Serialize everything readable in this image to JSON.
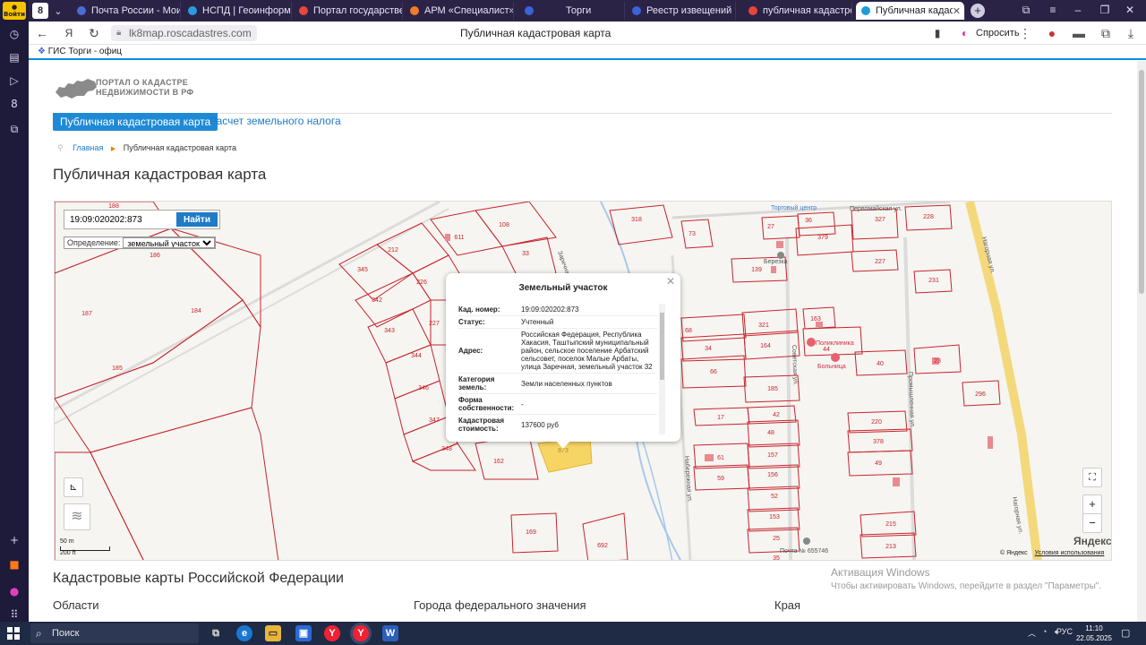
{
  "sidebar": {
    "login_label": "Войти"
  },
  "tabs": [
    {
      "label": "Почта России - Мои отп",
      "color": "#4c6bd8"
    },
    {
      "label": "НСПД | Геоинформаци",
      "color": "#2a9be0"
    },
    {
      "label": "Портал государственн",
      "color": "#e8453c"
    },
    {
      "label": "АРМ «Специалист»",
      "color": "#ef7b2f"
    },
    {
      "label": "Торги",
      "color": "#3a63d8"
    },
    {
      "label": "Реестр извещений",
      "color": "#3a63d8"
    },
    {
      "label": "публичная кадастрова",
      "color": "#e8453c"
    },
    {
      "label": "Публичная кадастрова",
      "color": "#1e9cd8"
    }
  ],
  "browser": {
    "url": "lk8map.roscadastres.com",
    "title": "Публичная кадастровая карта",
    "ask_label": "Спросить",
    "bookmark": "ГИС Торги - офиц"
  },
  "site": {
    "logo_line1": "ПОРТАЛ О КАДАСТРЕ",
    "logo_line2": "НЕДВИЖИМОСТИ В РФ",
    "nav_active": "Публичная кадастровая карта",
    "nav_tax": "Расчет земельного налога",
    "crumb_home": "Главная",
    "crumb_current": "Публичная кадастровая карта",
    "heading": "Публичная кадастровая карта"
  },
  "map": {
    "search_value": "19:09:020202:873",
    "search_button": "Найти",
    "definition_label": "Определение:",
    "definition_value": "земельный участок",
    "scale_m": "50 m",
    "scale_ft": "200 ft",
    "yandex": "Яндекс",
    "copyright": "© Яндекс",
    "terms": "Условия использования",
    "parcel_labels": [
      {
        "t": "188"
      },
      {
        "t": "186"
      },
      {
        "t": "187"
      },
      {
        "t": "184"
      },
      {
        "t": "185"
      },
      {
        "t": "345"
      },
      {
        "t": "212"
      },
      {
        "t": "342"
      },
      {
        "t": "226"
      },
      {
        "t": "343"
      },
      {
        "t": "227"
      },
      {
        "t": "344"
      },
      {
        "t": "346"
      },
      {
        "t": "347"
      },
      {
        "t": "348"
      },
      {
        "t": "162"
      },
      {
        "t": "611"
      },
      {
        "t": "108"
      },
      {
        "t": "33"
      },
      {
        "t": "318"
      },
      {
        "t": "73"
      },
      {
        "t": "27"
      },
      {
        "t": "36"
      },
      {
        "t": "379"
      },
      {
        "t": "327"
      },
      {
        "t": "228"
      },
      {
        "t": "227"
      },
      {
        "t": "139"
      },
      {
        "t": "231"
      },
      {
        "t": "68"
      },
      {
        "t": "321"
      },
      {
        "t": "163"
      },
      {
        "t": "34"
      },
      {
        "t": "164"
      },
      {
        "t": "44"
      },
      {
        "t": "66"
      },
      {
        "t": "40"
      },
      {
        "t": "23"
      },
      {
        "t": "185"
      },
      {
        "t": "296"
      },
      {
        "t": "17"
      },
      {
        "t": "42"
      },
      {
        "t": "220"
      },
      {
        "t": "48"
      },
      {
        "t": "378"
      },
      {
        "t": "61"
      },
      {
        "t": "157"
      },
      {
        "t": "49"
      },
      {
        "t": "59"
      },
      {
        "t": "156"
      },
      {
        "t": "52"
      },
      {
        "t": "169"
      },
      {
        "t": "692"
      },
      {
        "t": "153"
      },
      {
        "t": "215"
      },
      {
        "t": "25"
      },
      {
        "t": "213"
      },
      {
        "t": "35"
      },
      {
        "t": "873"
      }
    ],
    "street_labels": [
      {
        "t": "Первомайская ул."
      },
      {
        "t": "Нагорная ул."
      },
      {
        "t": "Советская ул."
      },
      {
        "t": "Промышленная ул."
      },
      {
        "t": "Набережная ул."
      },
      {
        "t": "Заречная"
      }
    ],
    "poi_labels": [
      {
        "t": "Торговый центр"
      },
      {
        "t": "Березка"
      },
      {
        "t": "Поликлиника"
      },
      {
        "t": "Больница"
      },
      {
        "t": "Почта № 655746"
      }
    ]
  },
  "popup": {
    "title": "Земельный участок",
    "rows": [
      {
        "k": "Кад. номер:",
        "v": "19:09:020202:873"
      },
      {
        "k": "Статус:",
        "v": "Учтенный"
      },
      {
        "k": "Адрес:",
        "v": "Российская Федерация, Республика Хакасия, Таштыпский муниципальный район, сельское поселение Арбатский сельсовет, поселок Малые Арбаты, улица Заречная, земельный участок 32"
      },
      {
        "k": "Категория земель:",
        "v": "Земли населенных пунктов"
      },
      {
        "k": "Форма собственности:",
        "v": "-"
      },
      {
        "k": "Кадастровая стоимость:",
        "v": "137600 руб"
      }
    ]
  },
  "lower": {
    "heading": "Кадастровые карты Российской Федерации",
    "col1": "Области",
    "col2": "Города федерального значения",
    "col3": "Края"
  },
  "activation": {
    "line1": "Активация Windows",
    "line2": "Чтобы активировать Windows, перейдите в раздел \"Параметры\"."
  },
  "taskbar": {
    "search": "Поиск",
    "lang": "РУС",
    "time": "11:10",
    "date": "22.05.2025"
  }
}
